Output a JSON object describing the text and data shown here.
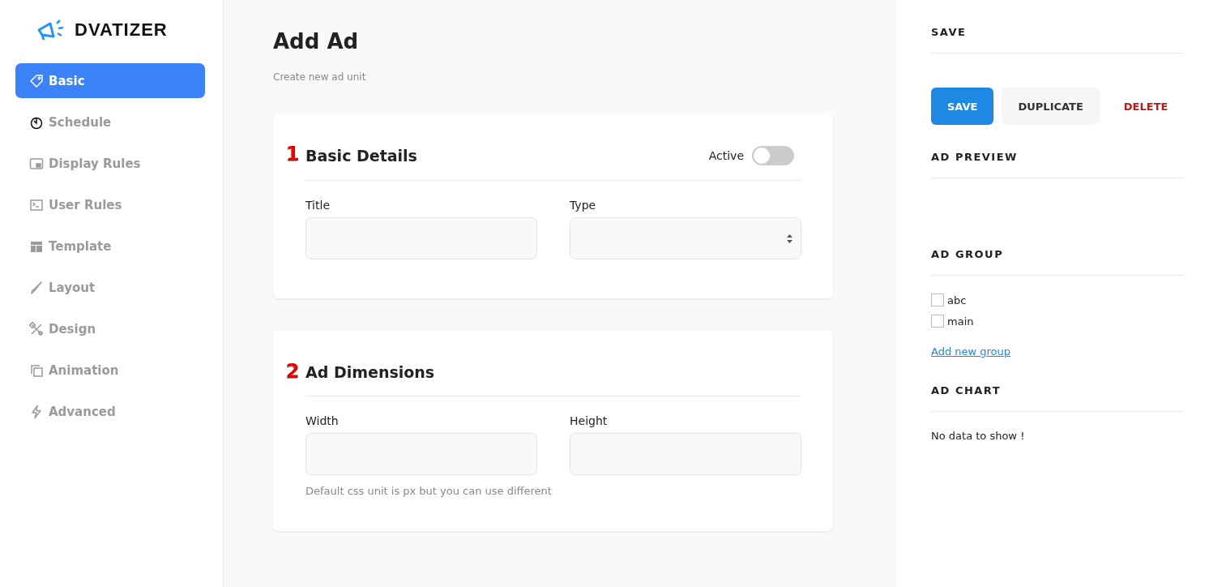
{
  "logo": {
    "text": "DVATIZER"
  },
  "sidebar": {
    "items": [
      {
        "label": "Basic",
        "selected": true
      },
      {
        "label": "Schedule",
        "selected": false
      },
      {
        "label": "Display Rules",
        "selected": false
      },
      {
        "label": "User Rules",
        "selected": false
      },
      {
        "label": "Template",
        "selected": false
      },
      {
        "label": "Layout",
        "selected": false
      },
      {
        "label": "Design",
        "selected": false
      },
      {
        "label": "Animation",
        "selected": false
      },
      {
        "label": "Advanced",
        "selected": false
      }
    ]
  },
  "page": {
    "title": "Add Ad",
    "subtitle": "Create new ad unit"
  },
  "sections": [
    {
      "step": "1",
      "title": "Basic Details",
      "toggle": {
        "label": "Active",
        "on": false
      },
      "fields": [
        {
          "label": "Title",
          "kind": "text"
        },
        {
          "label": "Type",
          "kind": "select"
        }
      ]
    },
    {
      "step": "2",
      "title": "Ad Dimensions",
      "fields": [
        {
          "label": "Width",
          "kind": "text"
        },
        {
          "label": "Height",
          "kind": "text"
        }
      ],
      "hint": "Default css unit is px but you can use different"
    }
  ],
  "right_panel": {
    "save": {
      "heading": "SAVE",
      "buttons": [
        {
          "label": "SAVE",
          "kind": "primary"
        },
        {
          "label": "DUPLICATE",
          "kind": "secondary"
        },
        {
          "label": "DELETE",
          "kind": "danger"
        }
      ]
    },
    "preview": {
      "heading": "AD PREVIEW"
    },
    "group": {
      "heading": "AD GROUP",
      "options": [
        {
          "label": "abc",
          "checked": false
        },
        {
          "label": "main",
          "checked": false
        }
      ],
      "link": "Add new group"
    },
    "chart": {
      "heading": "AD CHART",
      "message": "No data to show !"
    }
  }
}
